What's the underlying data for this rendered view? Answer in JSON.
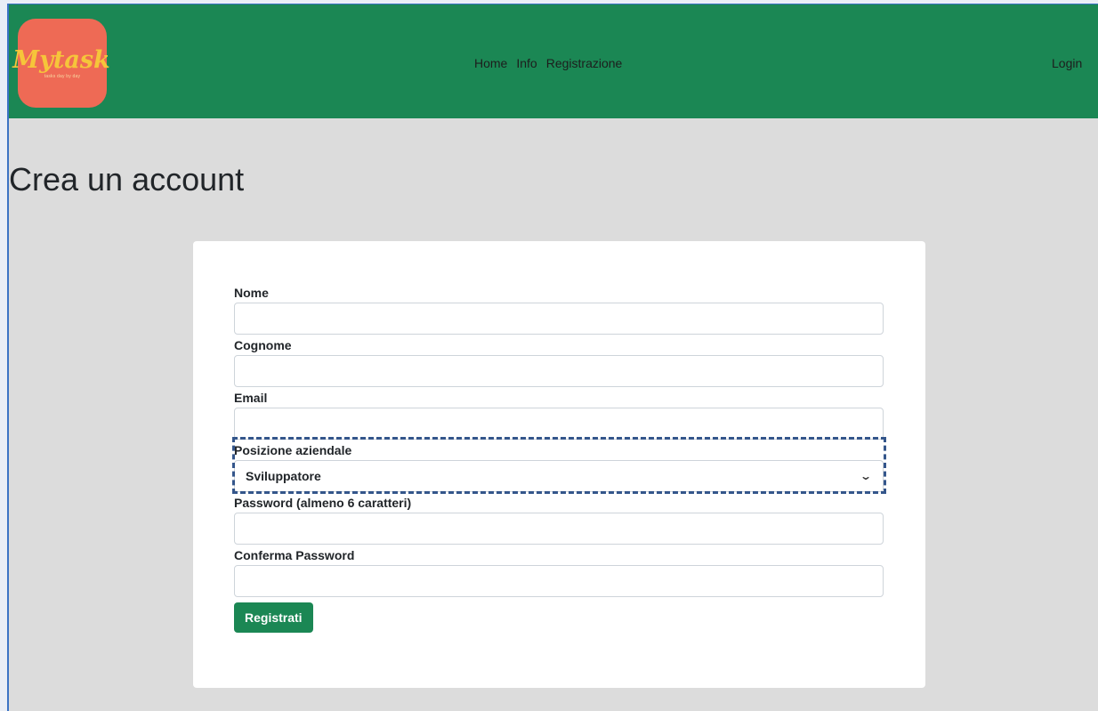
{
  "brand": {
    "logo_text": "Mytask",
    "tagline": "tasks day by day",
    "logo_color": "#ee6a55",
    "navbar_color": "#1b8754"
  },
  "nav": {
    "links": [
      "Home",
      "Info",
      "Registrazione"
    ],
    "login": "Login"
  },
  "page": {
    "title": "Crea un account"
  },
  "form": {
    "nome_label": "Nome",
    "cognome_label": "Cognome",
    "email_label": "Email",
    "posizione_label": "Posizione aziendale",
    "posizione_value": "Sviluppatore",
    "password_label": "Password (almeno 6 caratteri)",
    "conferma_label": "Conferma Password",
    "submit_label": "Registrati"
  },
  "icons": {
    "select_chevron": "chevron-down-icon"
  }
}
